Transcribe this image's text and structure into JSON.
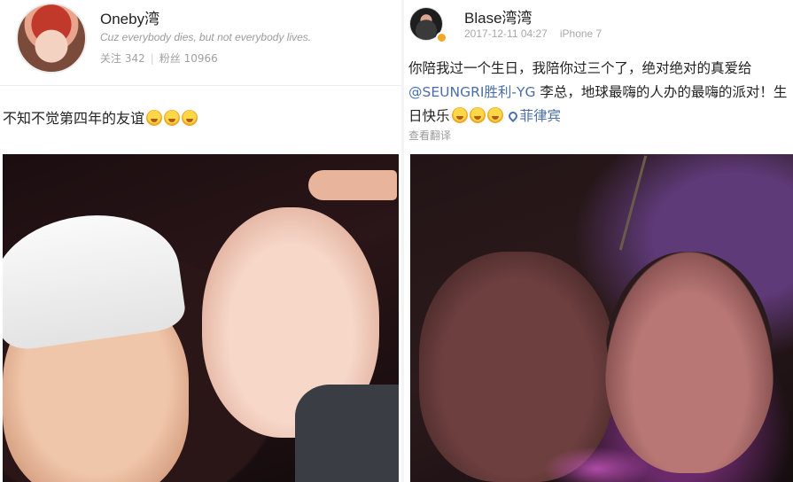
{
  "left_post": {
    "username": "Oneby湾",
    "bio": "Cuz everybody dies, but not everybody lives.",
    "following_label": "关注 342",
    "followers_label": "粉丝 10966",
    "separator": "|",
    "text": "不知不觉第四年的友谊",
    "emoji_count": 3,
    "emoji_icon": "crying-face-icon"
  },
  "right_post": {
    "username": "Blase湾湾",
    "timestamp": "2017-12-11 04:27",
    "device": "iPhone 7",
    "text_part1": "你陪我过一个生日，我陪你过三个了，绝对绝对的真爱给",
    "mention": "@SEUNGRI胜利-YG",
    "text_part2": " 李总，地球最嗨的人办的最嗨的派对！生日快乐",
    "emoji_count": 3,
    "emoji_icon": "crying-laughing-face-icon",
    "location": "菲律宾",
    "location_icon": "location-pin-icon",
    "translate_label": "查看翻译"
  },
  "colors": {
    "link": "#4a6ea9",
    "muted": "#9b9b9b",
    "badge": "#f5a623"
  }
}
